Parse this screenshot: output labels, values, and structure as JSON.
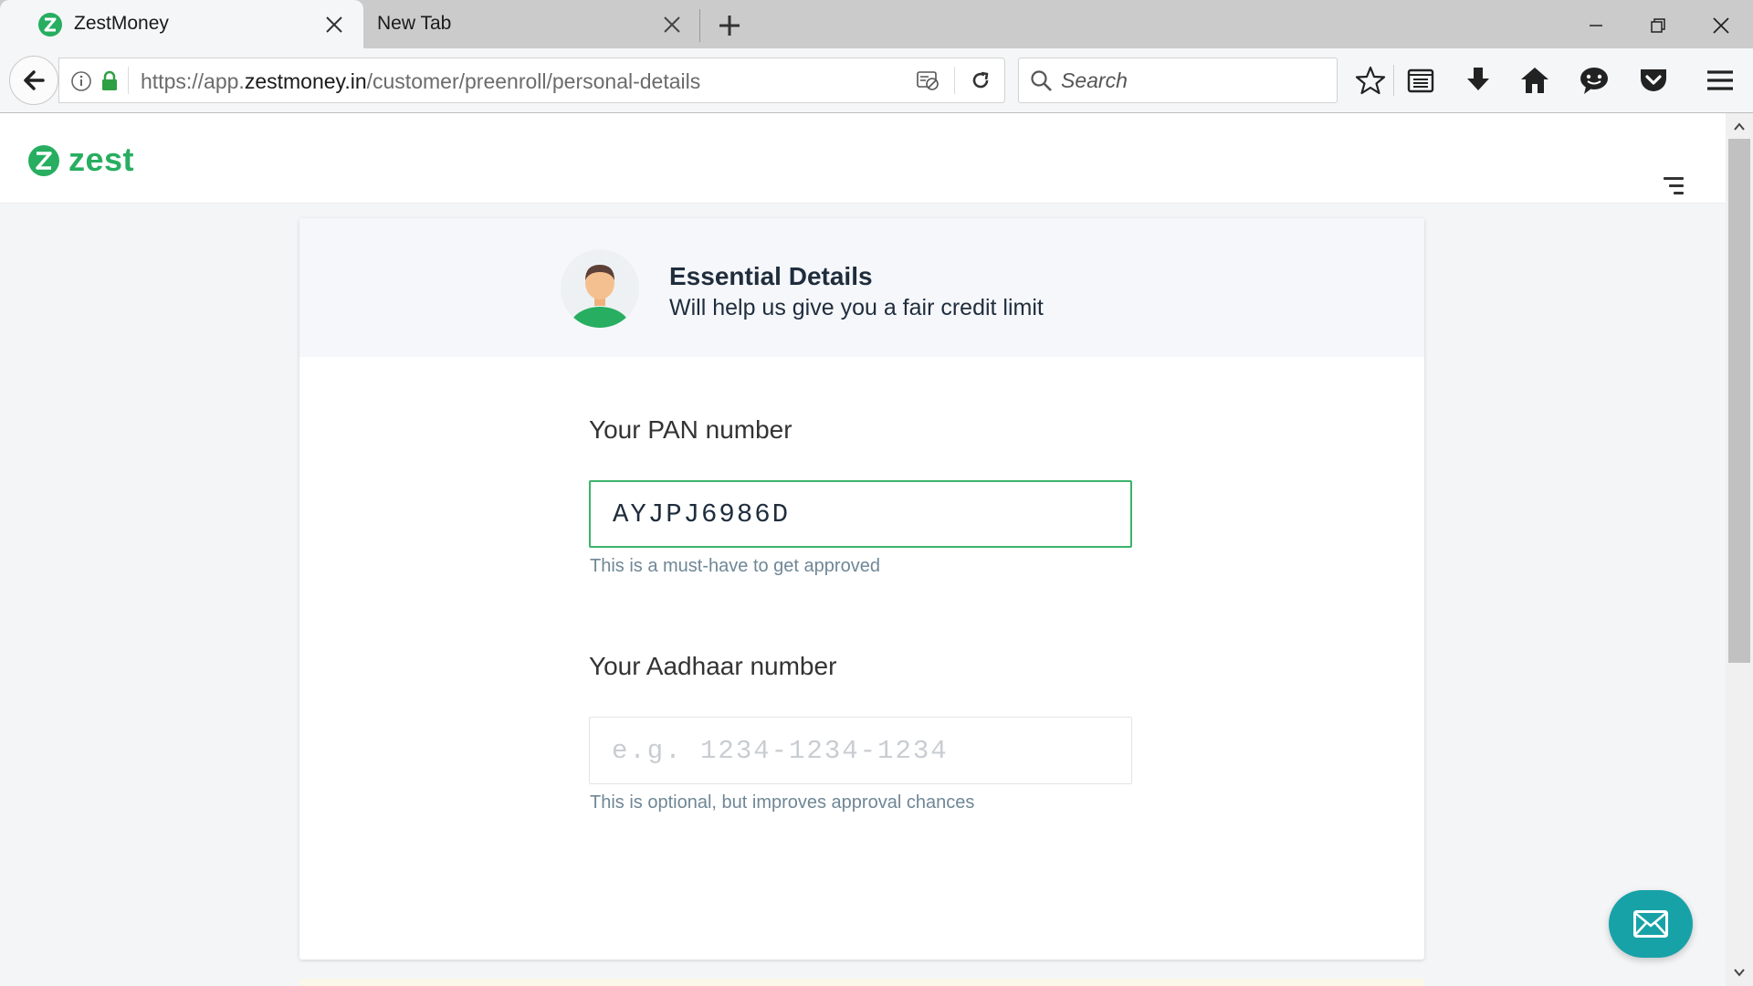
{
  "browser": {
    "tabs": [
      {
        "title": "ZestMoney",
        "active": true
      },
      {
        "title": "New Tab",
        "active": false
      }
    ],
    "url": {
      "prefix": "https://app.",
      "domain": "zestmoney.in",
      "path": "/customer/preenroll/personal-details"
    },
    "search_placeholder": "Search",
    "toolbar_icons": [
      "star-icon",
      "reading-list-icon",
      "download-icon",
      "home-icon",
      "chat-icon",
      "pocket-icon",
      "menu-icon"
    ]
  },
  "site": {
    "brand": "zest",
    "accent_color": "#27ae60",
    "chat_color": "#17a2a8"
  },
  "form": {
    "title": "Essential Details",
    "subtitle": "Will help us give you a fair credit limit",
    "pan": {
      "label": "Your PAN number",
      "value": "AYJPJ6986D",
      "hint": "This is a must-have to get approved"
    },
    "aadhaar": {
      "label": "Your Aadhaar number",
      "value": "",
      "placeholder": "e.g. 1234-1234-1234",
      "hint": "This is optional, but improves approval chances"
    }
  }
}
